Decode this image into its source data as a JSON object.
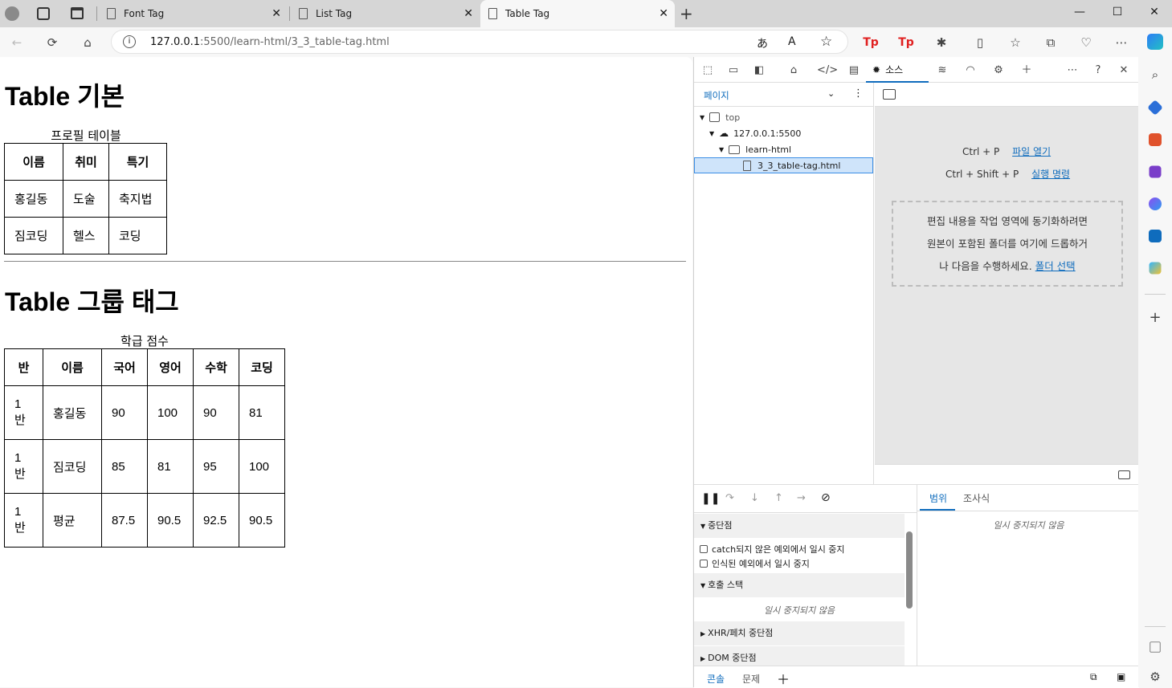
{
  "browser": {
    "tabs": [
      {
        "title": "Font Tag"
      },
      {
        "title": "List Tag"
      },
      {
        "title": "Table Tag"
      }
    ],
    "url_host": "127.0.0.1",
    "url_rest": ":5500/learn-html/3_3_table-tag.html",
    "new_tab_label": "+",
    "window_controls": {
      "minimize": "—",
      "maximize": "☐",
      "close": "✕"
    }
  },
  "page": {
    "heading1": "Table 기본",
    "table1": {
      "caption": "프로필 테이블",
      "headers": [
        "이름",
        "취미",
        "특기"
      ],
      "rows": [
        [
          "홍길동",
          "도술",
          "축지법"
        ],
        [
          "짐코딩",
          "헬스",
          "코딩"
        ]
      ]
    },
    "heading2": "Table 그룹 태그",
    "table2": {
      "caption": "학급 점수",
      "headers": [
        "반",
        "이름",
        "국어",
        "영어",
        "수학",
        "코딩"
      ],
      "rows": [
        [
          "1\n반",
          "홍길동",
          "90",
          "100",
          "90",
          "81"
        ],
        [
          "1\n반",
          "짐코딩",
          "85",
          "81",
          "95",
          "100"
        ],
        [
          "1\n반",
          "평균",
          "87.5",
          "90.5",
          "92.5",
          "90.5"
        ]
      ]
    }
  },
  "devtools": {
    "active_tab": "소스",
    "nav_tab": "페이지",
    "tree": [
      {
        "label": "top",
        "indent": 0,
        "kind": "frame"
      },
      {
        "label": "127.0.0.1:5500",
        "indent": 1,
        "kind": "cloud"
      },
      {
        "label": "learn-html",
        "indent": 2,
        "kind": "folder"
      },
      {
        "label": "3_3_table-tag.html",
        "indent": 3,
        "kind": "file"
      }
    ],
    "editor": {
      "open_file_shortcut": "Ctrl + P",
      "open_file_link": "파일 열기",
      "run_command_shortcut": "Ctrl + Shift + P",
      "run_command_link": "실행 명령",
      "drop_line1": "편집 내용을 작업 영역에 동기화하려면",
      "drop_line2": "원본이 포함된 폴더를 여기에 드롭하거",
      "drop_line3": "나 다음을 수행하세요.",
      "drop_link": "폴더 선택"
    },
    "debugger": {
      "breakpoints_title": "중단점",
      "opt1": "catch되지 않은 예외에서 일시 중지",
      "opt2": "인식된 예외에서 일시 중지",
      "callstack_title": "호출 스택",
      "not_paused": "일시 중지되지 않음",
      "xhr_title": "XHR/페치 중단점",
      "dom_title": "DOM 중단점"
    },
    "scope": {
      "tab_scope": "범위",
      "tab_watch": "조사식",
      "not_paused": "일시 중지되지 않음"
    },
    "drawer": {
      "console": "콘솔",
      "issues": "문제"
    }
  }
}
